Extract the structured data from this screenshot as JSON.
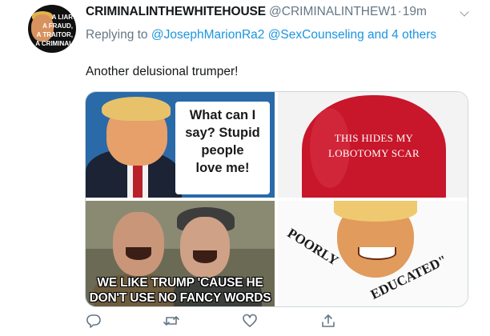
{
  "tweet": {
    "avatar": {
      "lines": [
        "A LIAR",
        "A FRAUD,",
        "A TRAITOR,",
        "A CRIMINAL"
      ]
    },
    "display_name": "CRIMINALINTHEWHITEHOUSE",
    "handle": "@CRIMINALINTHEW1",
    "separator": "·",
    "time": "19m",
    "reply": {
      "prefix": "Replying to ",
      "mentions": "@JosephMarionRa2 @SexCounseling and 4 others"
    },
    "text": "Another delusional trumper!",
    "media": {
      "panel1": {
        "lines": [
          "What can I",
          "say? Stupid",
          "people",
          "love me!"
        ]
      },
      "panel2": {
        "lines": [
          "THIS HIDES MY",
          "LOBOTOMY SCAR"
        ]
      },
      "panel3": {
        "lines": [
          "WE LIKE TRUMP 'CAUSE HE",
          "DON'T USE NO FANCY WORDS"
        ]
      },
      "panel4": {
        "arc1": "POORLY",
        "arc2": "EDUCATED\""
      }
    },
    "actions": [
      {
        "icon": "reply-icon"
      },
      {
        "icon": "retweet-icon"
      },
      {
        "icon": "like-icon"
      },
      {
        "icon": "share-icon"
      }
    ]
  },
  "colors": {
    "link": "#1b95e0",
    "meta": "#657786",
    "hat": "#c8162b"
  }
}
